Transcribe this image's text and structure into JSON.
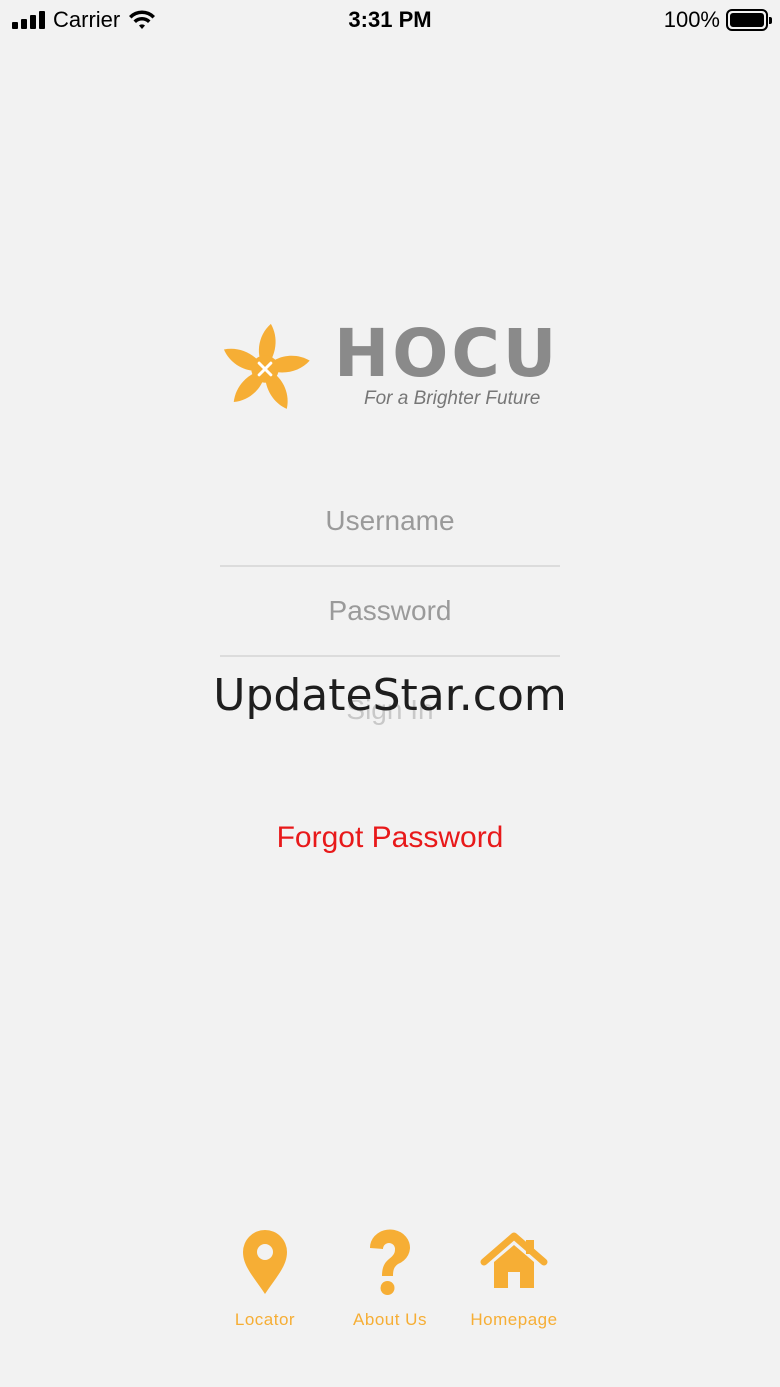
{
  "status_bar": {
    "carrier": "Carrier",
    "time": "3:31 PM",
    "battery": "100%"
  },
  "logo": {
    "brand": "HOCU",
    "tagline": "For a Brighter Future",
    "icon": "star-flower-logo"
  },
  "form": {
    "username_placeholder": "Username",
    "password_placeholder": "Password",
    "signin_label": "Sign In",
    "forgot_label": "Forgot Password"
  },
  "watermark": "UpdateStar.com",
  "tabbar": {
    "items": [
      {
        "label": "Locator",
        "icon": "map-pin-icon"
      },
      {
        "label": "About Us",
        "icon": "question-mark-icon"
      },
      {
        "label": "Homepage",
        "icon": "home-icon"
      }
    ]
  },
  "colors": {
    "accent": "#f6ae35",
    "link": "#e8191a",
    "background": "#f2f2f2",
    "brand_gray": "#8a8a8a"
  }
}
